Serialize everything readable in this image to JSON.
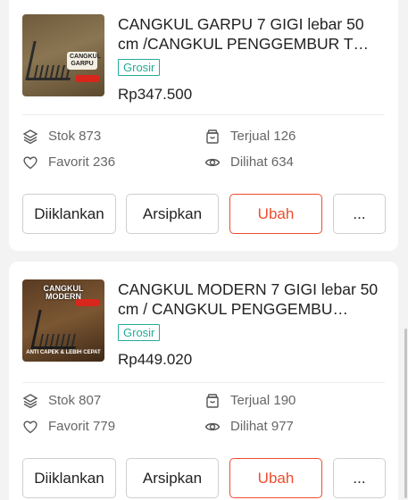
{
  "products": [
    {
      "title": "CANGKUL GARPU 7 GIGI lebar 50 cm /CANGKUL PENGGEMBUR T…",
      "tag": "Grosir",
      "price": "Rp347.500",
      "thumb_badge": "CANGKUL GARPU",
      "stats": {
        "stock_label": "Stok 873",
        "sold_label": "Terjual 126",
        "favorite_label": "Favorit 236",
        "views_label": "Dilihat 634"
      },
      "actions": {
        "promote": "Diiklankan",
        "archive": "Arsipkan",
        "edit": "Ubah",
        "more": "..."
      }
    },
    {
      "title": "CANGKUL MODERN 7 GIGI lebar 50 cm / CANGKUL PENGGEMBU…",
      "tag": "Grosir",
      "price": "Rp449.020",
      "thumb_badge": "CANGKUL MODERN",
      "thumb_caption": "ANTI CAPEK & LEBIH CEPAT",
      "stats": {
        "stock_label": "Stok 807",
        "sold_label": "Terjual 190",
        "favorite_label": "Favorit 779",
        "views_label": "Dilihat 977"
      },
      "actions": {
        "promote": "Diiklankan",
        "archive": "Arsipkan",
        "edit": "Ubah",
        "more": "..."
      }
    }
  ],
  "colors": {
    "accent": "#ee4d2d",
    "tag": "#26aa99",
    "muted": "#666666"
  }
}
